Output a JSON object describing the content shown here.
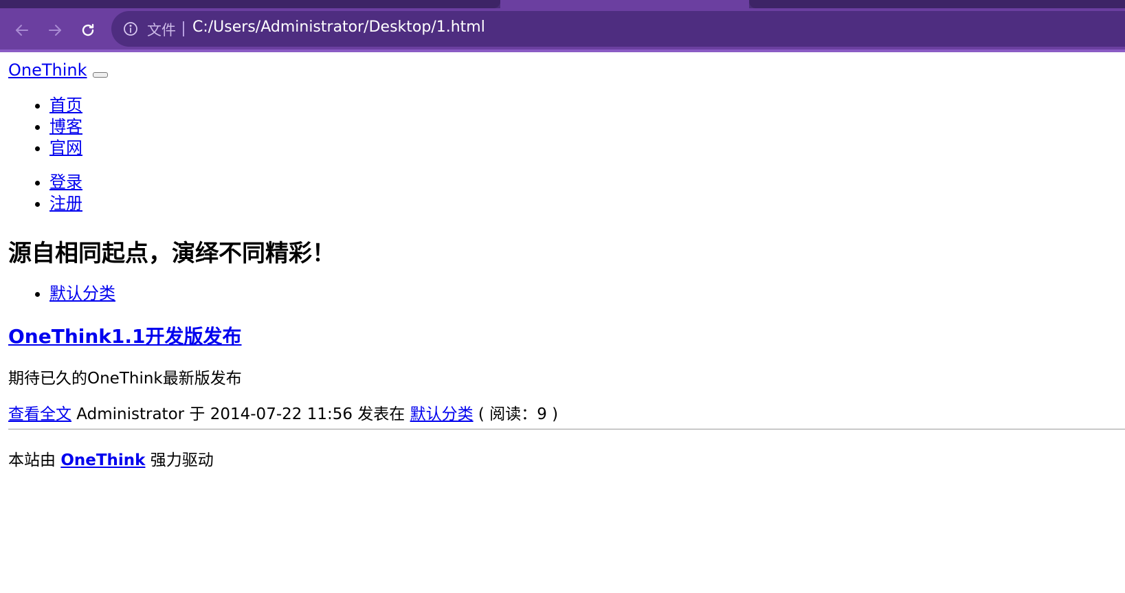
{
  "browser": {
    "scheme_label": "文件",
    "url": "C:/Users/Administrator/Desktop/1.html",
    "colors": {
      "frame": "#6b3fa0",
      "omnibox": "#4e2d80",
      "tabstrip": "#3d2466"
    }
  },
  "site": {
    "brand": "OneThink",
    "nav_primary": [
      {
        "label": "首页"
      },
      {
        "label": "博客"
      },
      {
        "label": "官网"
      }
    ],
    "nav_user": [
      {
        "label": "登录"
      },
      {
        "label": "注册"
      }
    ],
    "slogan": "源自相同起点，演绎不同精彩！",
    "categories": [
      {
        "label": "默认分类"
      }
    ]
  },
  "post": {
    "title": "OneThink1.1开发版发布",
    "excerpt": "期待已久的OneThink最新版发布",
    "read_more": "查看全文",
    "meta_author": " Administrator 于 2014-07-22 11:56 发表在 ",
    "category": "默认分类",
    "meta_reads": " ( 阅读：9 )"
  },
  "footer": {
    "prefix": "本站由 ",
    "brand": "OneThink",
    "suffix": " 强力驱动"
  },
  "colors": {
    "link": "#0000ee",
    "text": "#000000"
  }
}
